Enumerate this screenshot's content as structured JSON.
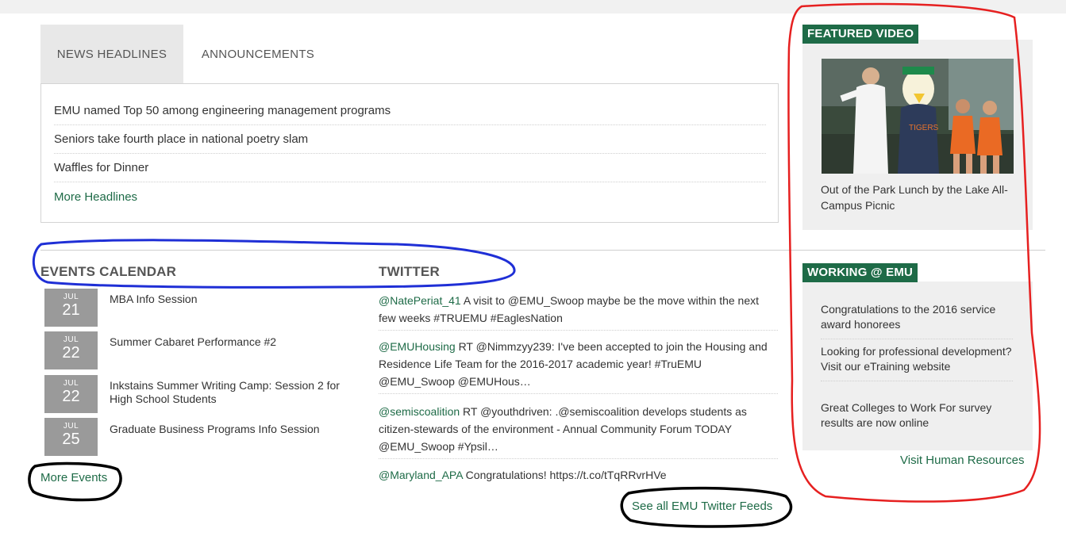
{
  "tabs": [
    {
      "label": "NEWS HEADLINES"
    },
    {
      "label": "ANNOUNCEMENTS"
    }
  ],
  "news": {
    "items": [
      "EMU named Top 50 among engineering management programs",
      "Seniors take fourth place in national poetry slam",
      "Waffles for Dinner"
    ],
    "more_label": "More Headlines"
  },
  "events": {
    "title": "EVENTS CALENDAR",
    "items": [
      {
        "month": "JUL",
        "day": "21",
        "title": "MBA Info Session"
      },
      {
        "month": "JUL",
        "day": "22",
        "title": "Summer Cabaret Performance #2"
      },
      {
        "month": "JUL",
        "day": "22",
        "title": "Inkstains Summer Writing Camp: Session 2 for High School Students"
      },
      {
        "month": "JUL",
        "day": "25",
        "title": "Graduate Business Programs Info Session"
      }
    ],
    "more_label": "More Events"
  },
  "twitter": {
    "title": "TWITTER",
    "tweets": [
      {
        "handle": "@NatePeriat_41",
        "text": " A visit to @EMU_Swoop maybe be the move within the next few weeks #TRUEMU #EaglesNation"
      },
      {
        "handle": "@EMUHousing",
        "text": " RT @Nimmzyy239: I've been accepted to join the Housing and Residence Life Team for the 2016-2017 academic year! #TruEMU @EMU_Swoop @EMUHous…"
      },
      {
        "handle": "@semiscoalition",
        "text": " RT @youthdriven: .@semiscoalition develops students as citizen-stewards of the environment - Annual Community Forum TODAY @EMU_Swoop #Ypsil…"
      },
      {
        "handle": "@Maryland_APA",
        "text": " Congratulations! https://t.co/tTqRRvrHVe"
      }
    ],
    "see_all_label": "See all EMU Twitter Feeds"
  },
  "featured_video": {
    "label": "FEATURED VIDEO",
    "caption": "Out of the Park Lunch by the Lake All-Campus Picnic"
  },
  "working": {
    "label": "WORKING @ EMU",
    "items": [
      "Congratulations to the 2016 service award honorees",
      "Looking for professional development? Visit our eTraining website",
      "Great Colleges to Work For survey results are now online"
    ],
    "link_label": "Visit Human Resources"
  },
  "colors": {
    "brand_green": "#1e6b47",
    "annotation_red": "#e62020",
    "annotation_blue": "#1f2fd6",
    "annotation_black": "#000000"
  }
}
